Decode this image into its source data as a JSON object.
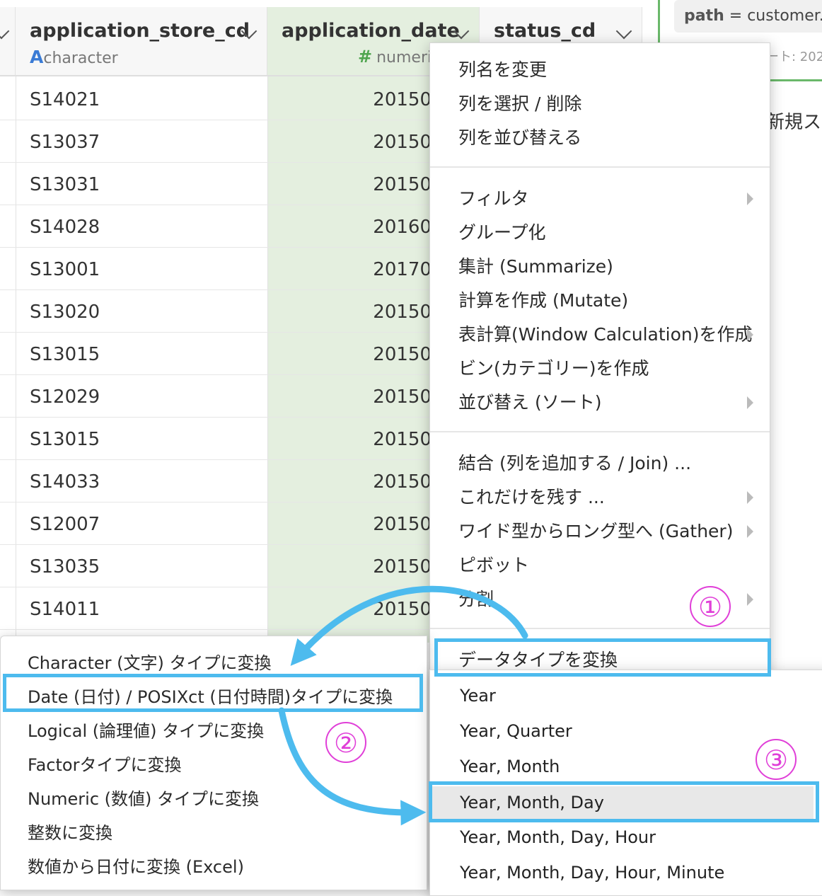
{
  "table": {
    "columns": [
      {
        "name": "application_store_cd",
        "type_glyph": "A",
        "type": "character"
      },
      {
        "name": "application_date",
        "type_glyph": "#",
        "type": "numeric"
      },
      {
        "name": "status_cd",
        "type_glyph": "",
        "type": ""
      }
    ],
    "rows": [
      {
        "store": "S14021",
        "date": "20150"
      },
      {
        "store": "S13037",
        "date": "20150"
      },
      {
        "store": "S13031",
        "date": "20150"
      },
      {
        "store": "S14028",
        "date": "20160"
      },
      {
        "store": "S13001",
        "date": "20170"
      },
      {
        "store": "S13020",
        "date": "20150"
      },
      {
        "store": "S13015",
        "date": "20150"
      },
      {
        "store": "S12029",
        "date": "20150"
      },
      {
        "store": "S13015",
        "date": "20150"
      },
      {
        "store": "S14033",
        "date": "20150"
      },
      {
        "store": "S12007",
        "date": "20150"
      },
      {
        "store": "S13035",
        "date": "20150"
      },
      {
        "store": "S14011",
        "date": "20150"
      }
    ]
  },
  "side_panel": {
    "path_key": "path",
    "path_value": "= customer.c",
    "subtext": "ート: 202",
    "step_text": "新規ステ"
  },
  "column_menu": {
    "group1": [
      "列名を変更",
      "列を選択 / 削除",
      "列を並び替える"
    ],
    "group2": [
      "フィルタ",
      "グループ化",
      "集計 (Summarize)",
      "計算を作成 (Mutate)",
      "表計算(Window Calculation)を作成",
      "ビン(カテゴリー)を作成",
      "並び替え (ソート)"
    ],
    "group3": [
      "結合 (列を追加する / Join) ...",
      "これだけを残す ...",
      "ワイド型からロング型へ (Gather)",
      "ピボット",
      "分割"
    ],
    "convert_type": "データタイプを変換"
  },
  "type_submenu": {
    "items": [
      "Character (文字) タイプに変換",
      "Date (日付) / POSIXct (日付時間)タイプに変換",
      "Logical (論理値) タイプに変換",
      "Factorタイプに変換",
      "Numeric (数値) タイプに変換",
      "整数に変換",
      "数値から日付に変換 (Excel)"
    ]
  },
  "date_submenu": {
    "items": [
      "Year",
      "Year, Quarter",
      "Year, Month",
      "Year, Month, Day",
      "Year, Month, Day, Hour",
      "Year, Month, Day, Hour, Minute"
    ]
  },
  "annotations": {
    "step1": "①",
    "step2": "②",
    "step3": "③",
    "highlight_color": "#4dbbee",
    "number_color": "#e03fd8"
  }
}
